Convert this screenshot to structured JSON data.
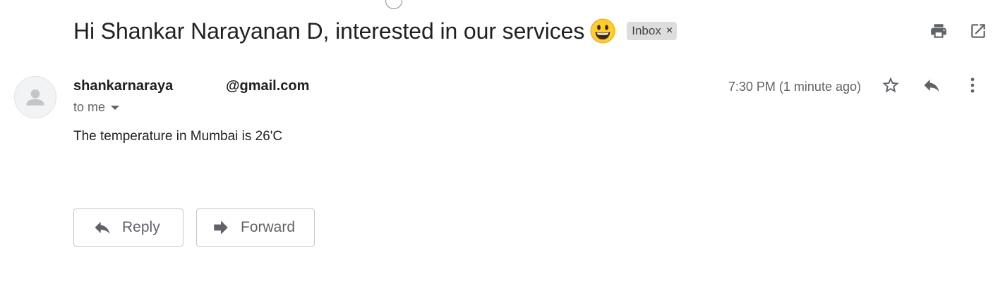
{
  "subject": {
    "text": "Hi Shankar Narayanan D, interested in our services",
    "emoji": "smiling-face-icon"
  },
  "label": {
    "name": "Inbox",
    "remove_glyph": "×"
  },
  "toolbar": {
    "print_icon": "print-icon",
    "open_new_window_icon": "open-in-new-window-icon"
  },
  "message": {
    "sender_local": "shankarnaraya",
    "sender_domain": "@gmail.com",
    "recipient": "to me",
    "time": "7:30 PM (1 minute ago)",
    "body": "The temperature in Mumbai is 26'C"
  },
  "actions": {
    "reply_label": "Reply",
    "forward_label": "Forward"
  },
  "colors": {
    "icon_gray": "#5f6368",
    "chip_bg": "#dddddd",
    "emoji_yellow": "#ffcb2e"
  }
}
